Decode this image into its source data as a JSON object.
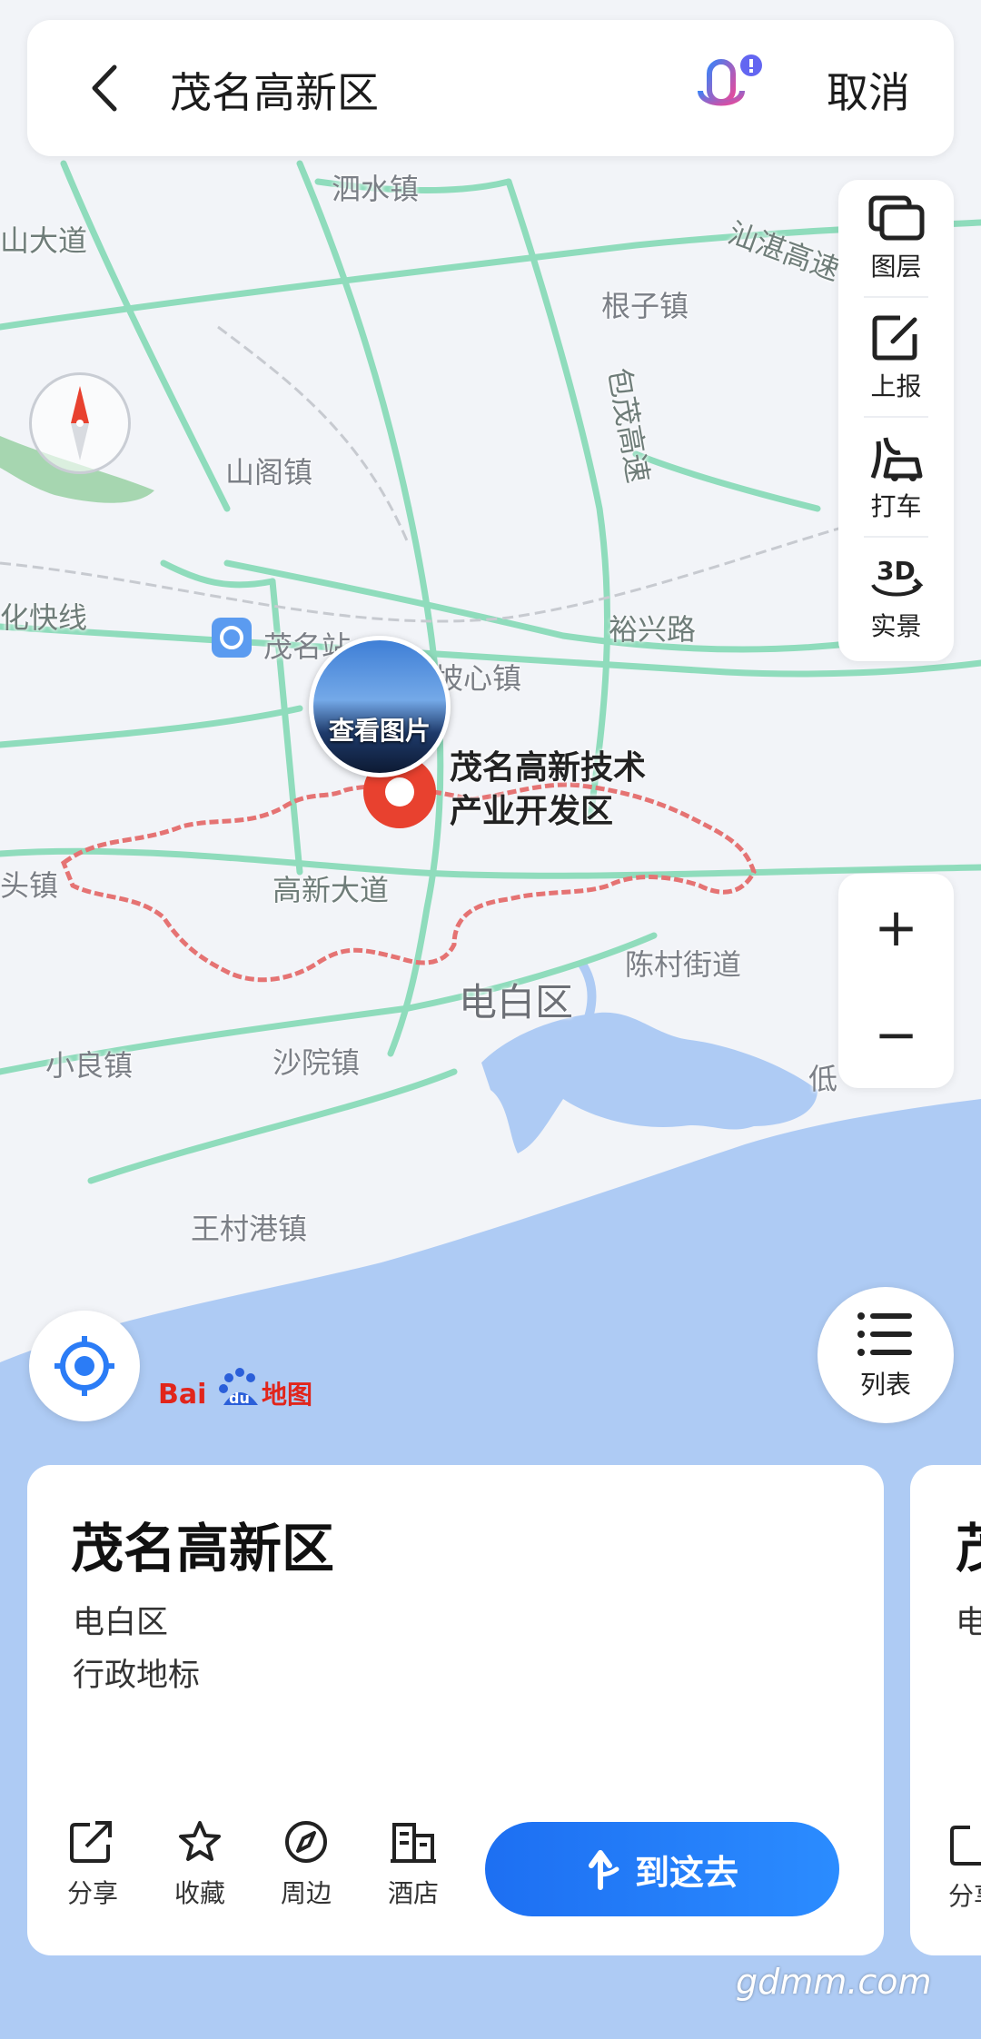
{
  "search": {
    "query": "茂名高新区",
    "cancel_label": "取消"
  },
  "tools": [
    {
      "label": "图层",
      "icon": "layers-icon"
    },
    {
      "label": "上报",
      "icon": "report-edit-icon"
    },
    {
      "label": "打车",
      "icon": "taxi-icon"
    },
    {
      "label": "实景",
      "icon": "3d-view-icon"
    }
  ],
  "zoom": {
    "in": "+",
    "out": "−"
  },
  "map": {
    "labels": [
      "泗水镇",
      "山大道",
      "汕湛高速",
      "根子镇",
      "包茂高速",
      "山阁镇",
      "化快线",
      "茂名站",
      "坡心镇",
      "裕兴路",
      "高新大道",
      "陈村街道",
      "电白区",
      "小良镇",
      "沙院镇",
      "王村港镇",
      "头镇",
      "低"
    ],
    "photo_caption": "查看图片",
    "poi_name_line1": "茂名高新技术",
    "poi_name_line2": "产业开发区",
    "logo_text": "Baidu地图"
  },
  "list_label": "列表",
  "card": {
    "title": "茂名高新区",
    "district": "电白区",
    "category": "行政地标",
    "actions": [
      {
        "label": "分享",
        "icon": "share-icon"
      },
      {
        "label": "收藏",
        "icon": "star-icon"
      },
      {
        "label": "周边",
        "icon": "compass-nearby-icon"
      },
      {
        "label": "酒店",
        "icon": "hotel-icon"
      }
    ],
    "go_label": "到这去"
  },
  "card2": {
    "title_partial": "茂",
    "sub_partial": "电",
    "action_partial": "分享"
  },
  "watermark": "gdmm.com",
  "colors": {
    "water": "#aecbf4",
    "road": "#7fd8b4",
    "boundary": "#e57373",
    "accent": "#2b7cf6",
    "pin": "#e8412f"
  }
}
